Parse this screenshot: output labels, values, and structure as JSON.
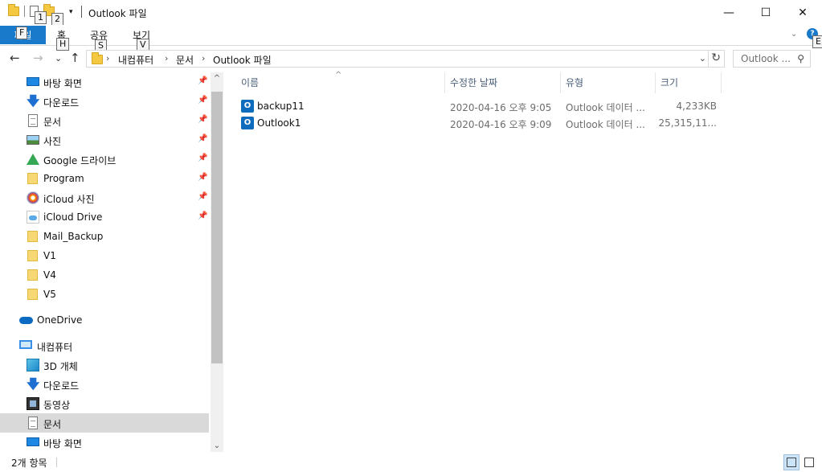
{
  "window": {
    "title": "Outlook 파일",
    "minimize_glyph": "—",
    "maximize_glyph": "☐",
    "close_glyph": "✕"
  },
  "quick_access_toolbar": {
    "keytips": [
      "1",
      "2"
    ],
    "dropdown_glyph": "▾"
  },
  "ribbon": {
    "file_tab": {
      "label": "파일",
      "keytip": "F"
    },
    "tabs": [
      {
        "label": "홈",
        "keytip": "H"
      },
      {
        "label": "공유",
        "keytip": "S"
      },
      {
        "label": "보기",
        "keytip": "V"
      }
    ],
    "expand_glyph": "⌄",
    "help_glyph": "?",
    "help_keytip": "E"
  },
  "navigation": {
    "back_glyph": "←",
    "forward_glyph": "→",
    "recent_glyph": "⌄",
    "up_glyph": "↑"
  },
  "address_bar": {
    "breadcrumbs": [
      "내컴퓨터",
      "문서",
      "Outlook 파일"
    ],
    "separator": "›",
    "dropdown_glyph": "⌄",
    "refresh_glyph": "↻"
  },
  "search": {
    "placeholder": "Outlook ...",
    "icon_glyph": "⚲"
  },
  "nav_pane": {
    "pin_glyph": "📌",
    "quick_access": [
      {
        "label": "바탕 화면",
        "icon": "desktop-icon",
        "pinned": true
      },
      {
        "label": "다운로드",
        "icon": "download-icon",
        "pinned": true
      },
      {
        "label": "문서",
        "icon": "document-icon",
        "pinned": true
      },
      {
        "label": "사진",
        "icon": "picture-icon",
        "pinned": true
      },
      {
        "label": "Google 드라이브",
        "icon": "google-drive-icon",
        "pinned": true
      },
      {
        "label": "Program",
        "icon": "folder-icon",
        "pinned": true
      },
      {
        "label": "iCloud 사진",
        "icon": "icloud-photos-icon",
        "pinned": true
      },
      {
        "label": "iCloud Drive",
        "icon": "icloud-drive-icon",
        "pinned": true
      },
      {
        "label": "Mail_Backup",
        "icon": "folder-icon",
        "pinned": false
      },
      {
        "label": "V1",
        "icon": "folder-icon",
        "pinned": false
      },
      {
        "label": "V4",
        "icon": "folder-icon",
        "pinned": false
      },
      {
        "label": "V5",
        "icon": "folder-icon",
        "pinned": false
      }
    ],
    "onedrive": {
      "label": "OneDrive",
      "icon": "onedrive-icon"
    },
    "this_pc": {
      "label": "내컴퓨터",
      "icon": "computer-icon"
    },
    "this_pc_items": [
      {
        "label": "3D 개체",
        "icon": "3d-objects-icon"
      },
      {
        "label": "다운로드",
        "icon": "download-icon"
      },
      {
        "label": "동영상",
        "icon": "video-icon"
      },
      {
        "label": "문서",
        "icon": "document-icon",
        "selected": true
      },
      {
        "label": "바탕 화면",
        "icon": "desktop-icon"
      }
    ],
    "scroll_up_glyph": "^",
    "scroll_down_glyph": "⌄"
  },
  "file_list": {
    "columns": [
      "이름",
      "수정한 날짜",
      "유형",
      "크기"
    ],
    "sort_glyph": "^",
    "files": [
      {
        "name": "backup11",
        "modified": "2020-04-16 오후 9:05",
        "type": "Outlook 데이터 ...",
        "size": "4,233KB",
        "icon": "outlook-data-file-icon"
      },
      {
        "name": "Outlook1",
        "modified": "2020-04-16 오후 9:09",
        "type": "Outlook 데이터 ...",
        "size": "25,315,11...",
        "icon": "outlook-data-file-icon"
      }
    ]
  },
  "status_bar": {
    "item_count": "2개 항목"
  },
  "colors": {
    "accent": "#1979ca",
    "selected_nav": "#d9d9d9",
    "header_text": "#4c607a"
  }
}
